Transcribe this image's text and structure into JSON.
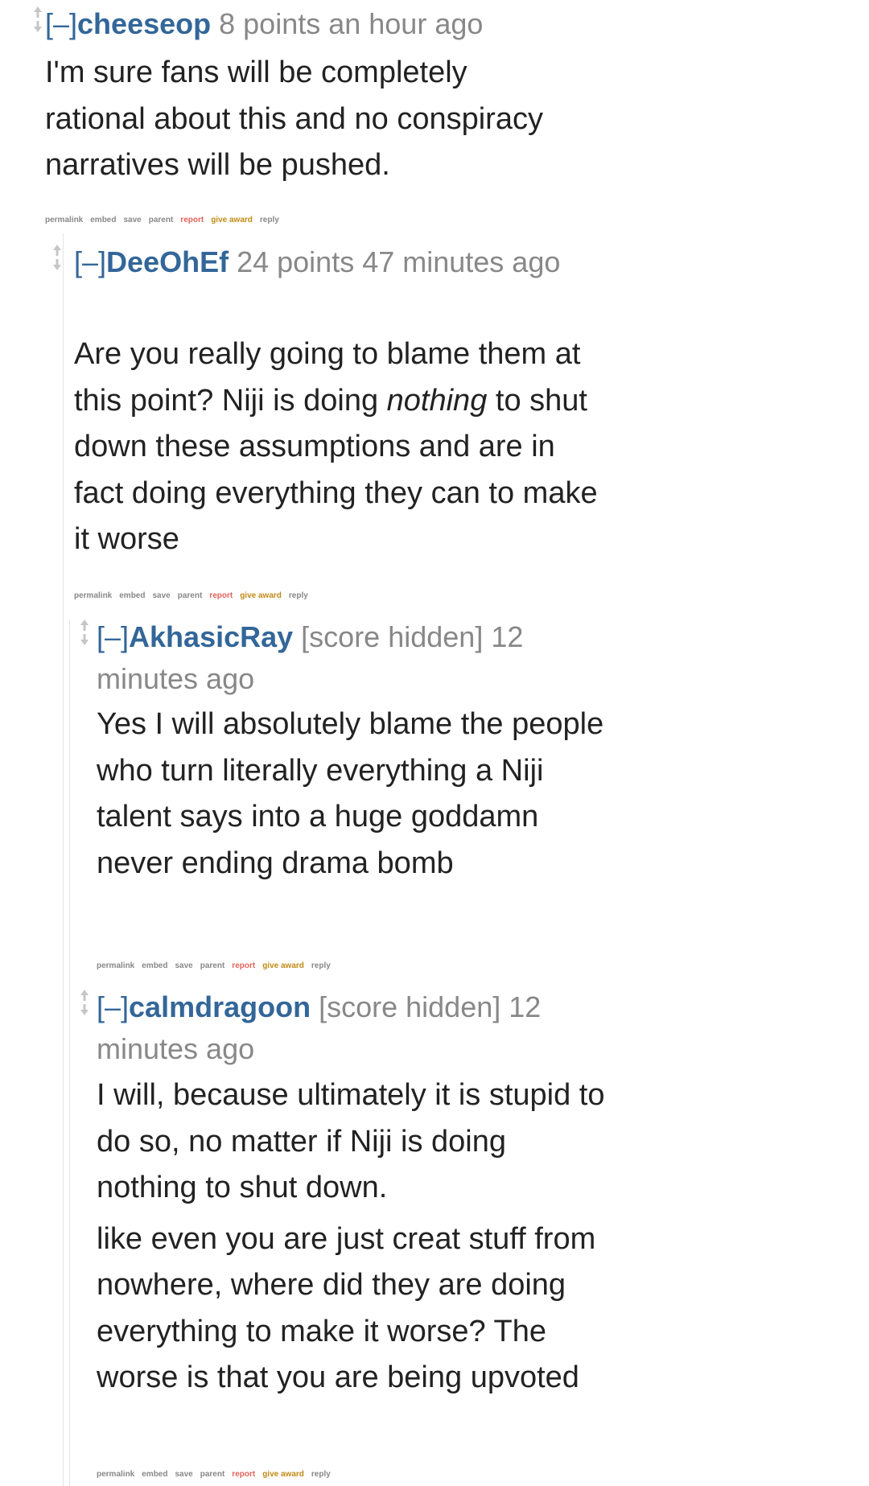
{
  "comments": [
    {
      "expand": "[–]",
      "author": "cheeseop",
      "meta": "8 points an hour ago",
      "body": [
        "I'm sure fans will be completely rational about this and no conspiracy narratives will be pushed."
      ]
    },
    {
      "expand": "[–]",
      "author": "DeeOhEf",
      "meta": "24 points 47 minutes ago",
      "body_before": "Are you really going to blame them at this point? Niji is doing ",
      "body_em": "nothing",
      "body_after": " to shut down these assumptions and are in fact doing everything they can to make it worse"
    },
    {
      "expand": "[–]",
      "author": "AkhasicRay",
      "meta": "[score hidden] 12 minutes ago",
      "body": [
        "Yes I will absolutely blame the people who turn literally everything a Niji talent says into a huge goddamn never ending drama bomb"
      ]
    },
    {
      "expand": "[–]",
      "author": "calmdragoon",
      "meta": "[score hidden] 12 minutes ago",
      "body": [
        "I will, because ultimately it is stupid to do so, no matter if Niji is doing nothing to shut down.",
        "like even you are just creat stuff from nowhere, where did they are doing everything to make it worse? The worse is that you are being upvoted"
      ]
    }
  ],
  "actions": {
    "permalink": "permalink",
    "embed": "embed",
    "save": "save",
    "parent": "parent",
    "report": "report",
    "give_award": "give award",
    "reply": "reply"
  },
  "colors": {
    "author": "#336699",
    "meta": "#888888",
    "body": "#222222",
    "report": "#e0635a",
    "give_award": "#c08a14",
    "thread_line": "#e4e4e4"
  }
}
